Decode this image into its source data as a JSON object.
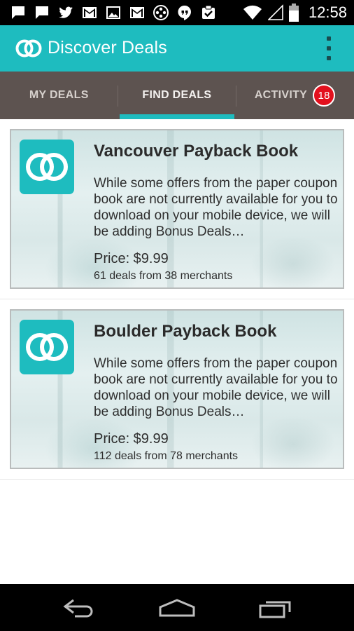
{
  "status_bar": {
    "time": "12:58",
    "notification_icons": [
      "chat-icon",
      "chat-icon",
      "twitter-icon",
      "gmail-icon",
      "image-icon",
      "gmail-icon",
      "movie-reel-icon",
      "hangouts-icon",
      "task-check-icon"
    ],
    "system_icons": [
      "wifi-icon",
      "cellular-signal-icon",
      "battery-icon"
    ]
  },
  "app_bar": {
    "title": "Discover Deals",
    "overflow_icon": "overflow-menu-icon"
  },
  "tabs": [
    {
      "label": "MY DEALS",
      "active": false
    },
    {
      "label": "FIND DEALS",
      "active": true
    },
    {
      "label": "ACTIVITY",
      "active": false,
      "badge": "18"
    }
  ],
  "colors": {
    "accent": "#1ebcbf",
    "tab_bar": "#5d5350",
    "badge": "#e3101d"
  },
  "deals": [
    {
      "title": "Vancouver Payback Book",
      "description": "While some offers from the paper coupon book are not currently available for you to download on your mobile device, we will be adding Bonus Deals…",
      "price": "Price: $9.99",
      "meta": "61 deals from 38 merchants"
    },
    {
      "title": "Boulder Payback Book",
      "description": "While some offers from the paper coupon book are not currently available for you to download on your mobile device, we will be adding Bonus Deals…",
      "price": "Price: $9.99",
      "meta": "112 deals from 78 merchants"
    }
  ],
  "nav_bar": {
    "buttons": [
      "back-icon",
      "home-icon",
      "recent-apps-icon"
    ]
  }
}
